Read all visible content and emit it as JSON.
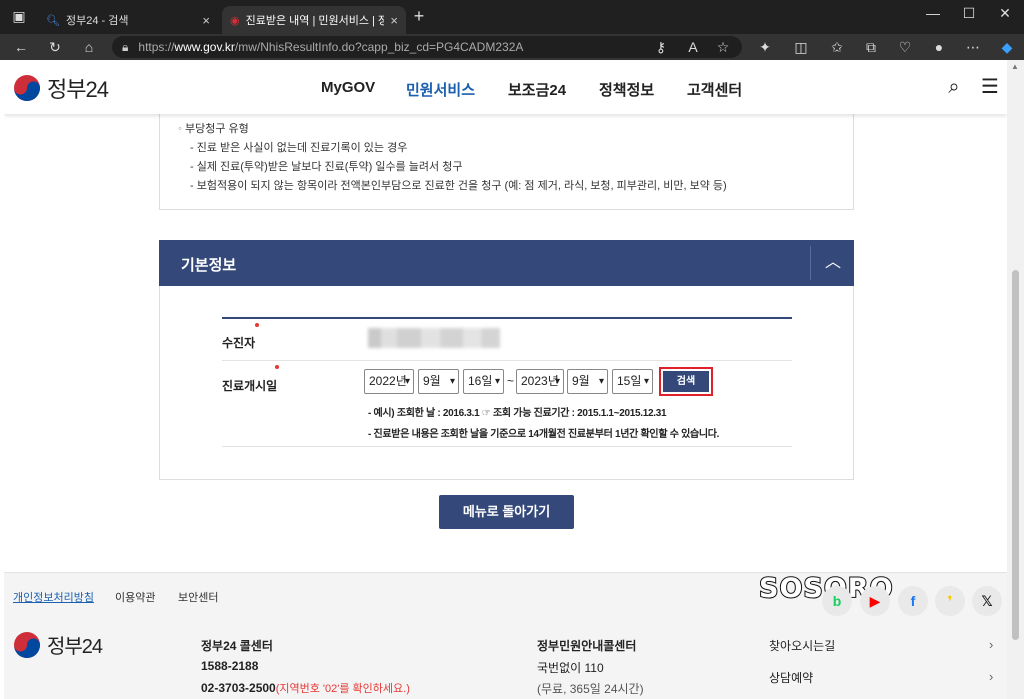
{
  "browser": {
    "tabs": [
      {
        "title": "정부24 - 검색",
        "close": "×"
      },
      {
        "title": "진료받은 내역 | 민원서비스 | 정부",
        "close": "×"
      }
    ],
    "new_tab": "+",
    "url_prefix": "https://",
    "url_host": "www.gov.kr",
    "url_path": "/mw/NhisResultInfo.do?capp_biz_cd=PG4CADM232A"
  },
  "site": {
    "logo": "정부24",
    "nav": [
      "MyGOV",
      "민원서비스",
      "보조금24",
      "정책정보",
      "고객센터"
    ],
    "active_nav": "민원서비스"
  },
  "claim_box": {
    "heading": "부당청구 유형",
    "items": [
      "- 진료 받은 사실이 없는데 진료기록이 있는 경우",
      "- 실제 진료(투약)받은 날보다 진료(투약) 일수를 늘려서 청구",
      "- 보험적용이 되지 않는 항목이라 전액본인부담으로 진료한 건을 청구 (예: 점 제거, 라식, 보청, 피부관리, 비만, 보약 등)"
    ]
  },
  "basic_info": {
    "title": "기본정보",
    "patient_label": "수진자",
    "date_label": "진료개시일",
    "from": {
      "year": "2022년",
      "month": "9월",
      "day": "16일"
    },
    "tilde": "~",
    "to": {
      "year": "2023년",
      "month": "9월",
      "day": "15일"
    },
    "search_button": "검색",
    "note1": "- 예시) 조회한 날 : 2016.3.1 ☞ 조회 가능 진료기간 : 2015.1.1~2015.12.31",
    "note2": "- 진료받은 내용은 조회한 날을 기준으로 14개월전 진료분부터 1년간 확인할 수 있습니다."
  },
  "back_button": "메뉴로 돌아가기",
  "watermark": "SOSORO",
  "footer": {
    "links": [
      "개인정보처리방침",
      "이용약관",
      "보안센터"
    ],
    "logo": "정부24",
    "callcenter_title": "정부24 콜센터",
    "callcenter_phone": "1588-2188",
    "callcenter_phone2": "02-3703-2500",
    "callcenter_note": "(지역번호 '02'를 확인하세요.)",
    "civil_title": "정부민원안내콜센터",
    "civil_phone": "국번없이 110",
    "civil_note": "(무료, 365일 24시간)",
    "directions": "찾아오시는길",
    "reservation": "상담예약"
  },
  "colors": {
    "primary": "#34497a",
    "accent_blue": "#1a5fb0",
    "highlight_red": "#e0202a"
  }
}
